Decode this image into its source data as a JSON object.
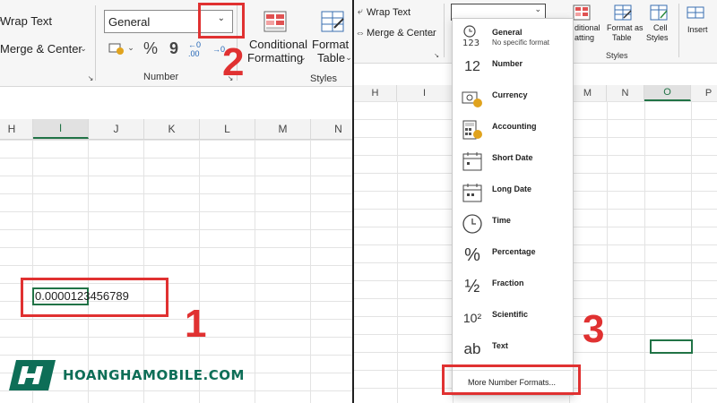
{
  "left": {
    "ribbon": {
      "wrap_text": "Wrap Text",
      "merge_center": "Merge & Center",
      "number_format_value": "General",
      "conditional": "Conditional",
      "formatting": "Formatting",
      "format_as": "Format a",
      "table": "Table",
      "number_group": "Number",
      "styles_group": "Styles",
      "percent_symbol": "%",
      "comma_symbol": "9",
      "dec_increase": "←0 .00",
      "dec_decrease": "→0"
    },
    "columns": [
      "H",
      "I",
      "J",
      "K",
      "L",
      "M",
      "N"
    ],
    "selected_column": "I",
    "cell_value": "0.0000123456789",
    "step_1": "1",
    "step_2": "2"
  },
  "right": {
    "ribbon": {
      "wrap_text": "Wrap Text",
      "merge_center": "Merge & Center",
      "cond_partial": "ditional",
      "cond_partial2": "atting",
      "format_as": "Format as",
      "table": "Table",
      "cell": "Cell",
      "styles": "Styles",
      "insert": "Insert",
      "styles_group": "Styles"
    },
    "columns_left": [
      "H",
      "I"
    ],
    "columns_right": [
      "M",
      "N",
      "O",
      "P"
    ],
    "selected_column": "O",
    "dropdown_items": [
      {
        "label": "General",
        "sub": "No specific format",
        "icon": "clock-123-icon"
      },
      {
        "label": "Number",
        "sub": "",
        "icon": "number-12-icon"
      },
      {
        "label": "Currency",
        "sub": "",
        "icon": "currency-icon"
      },
      {
        "label": "Accounting",
        "sub": "",
        "icon": "accounting-icon"
      },
      {
        "label": "Short Date",
        "sub": "",
        "icon": "calendar-icon"
      },
      {
        "label": "Long Date",
        "sub": "",
        "icon": "calendar-icon"
      },
      {
        "label": "Time",
        "sub": "",
        "icon": "clock-icon"
      },
      {
        "label": "Percentage",
        "sub": "",
        "icon": "percent-icon"
      },
      {
        "label": "Fraction",
        "sub": "",
        "icon": "fraction-icon"
      },
      {
        "label": "Scientific",
        "sub": "",
        "icon": "scientific-icon"
      },
      {
        "label": "Text",
        "sub": "",
        "icon": "text-ab-icon"
      }
    ],
    "icon_glyphs": {
      "number": "12",
      "percent": "%",
      "fraction": "½",
      "scientific": "10²",
      "text": "ab",
      "general": "123"
    },
    "more_formats": "More Number Formats...",
    "step_3": "3"
  },
  "logo": {
    "text": "HOANGHAMOBILE.COM",
    "mark": "H"
  },
  "colors": {
    "accent_red": "#e03131",
    "excel_green": "#217346",
    "logo_green": "#0e6e57"
  }
}
